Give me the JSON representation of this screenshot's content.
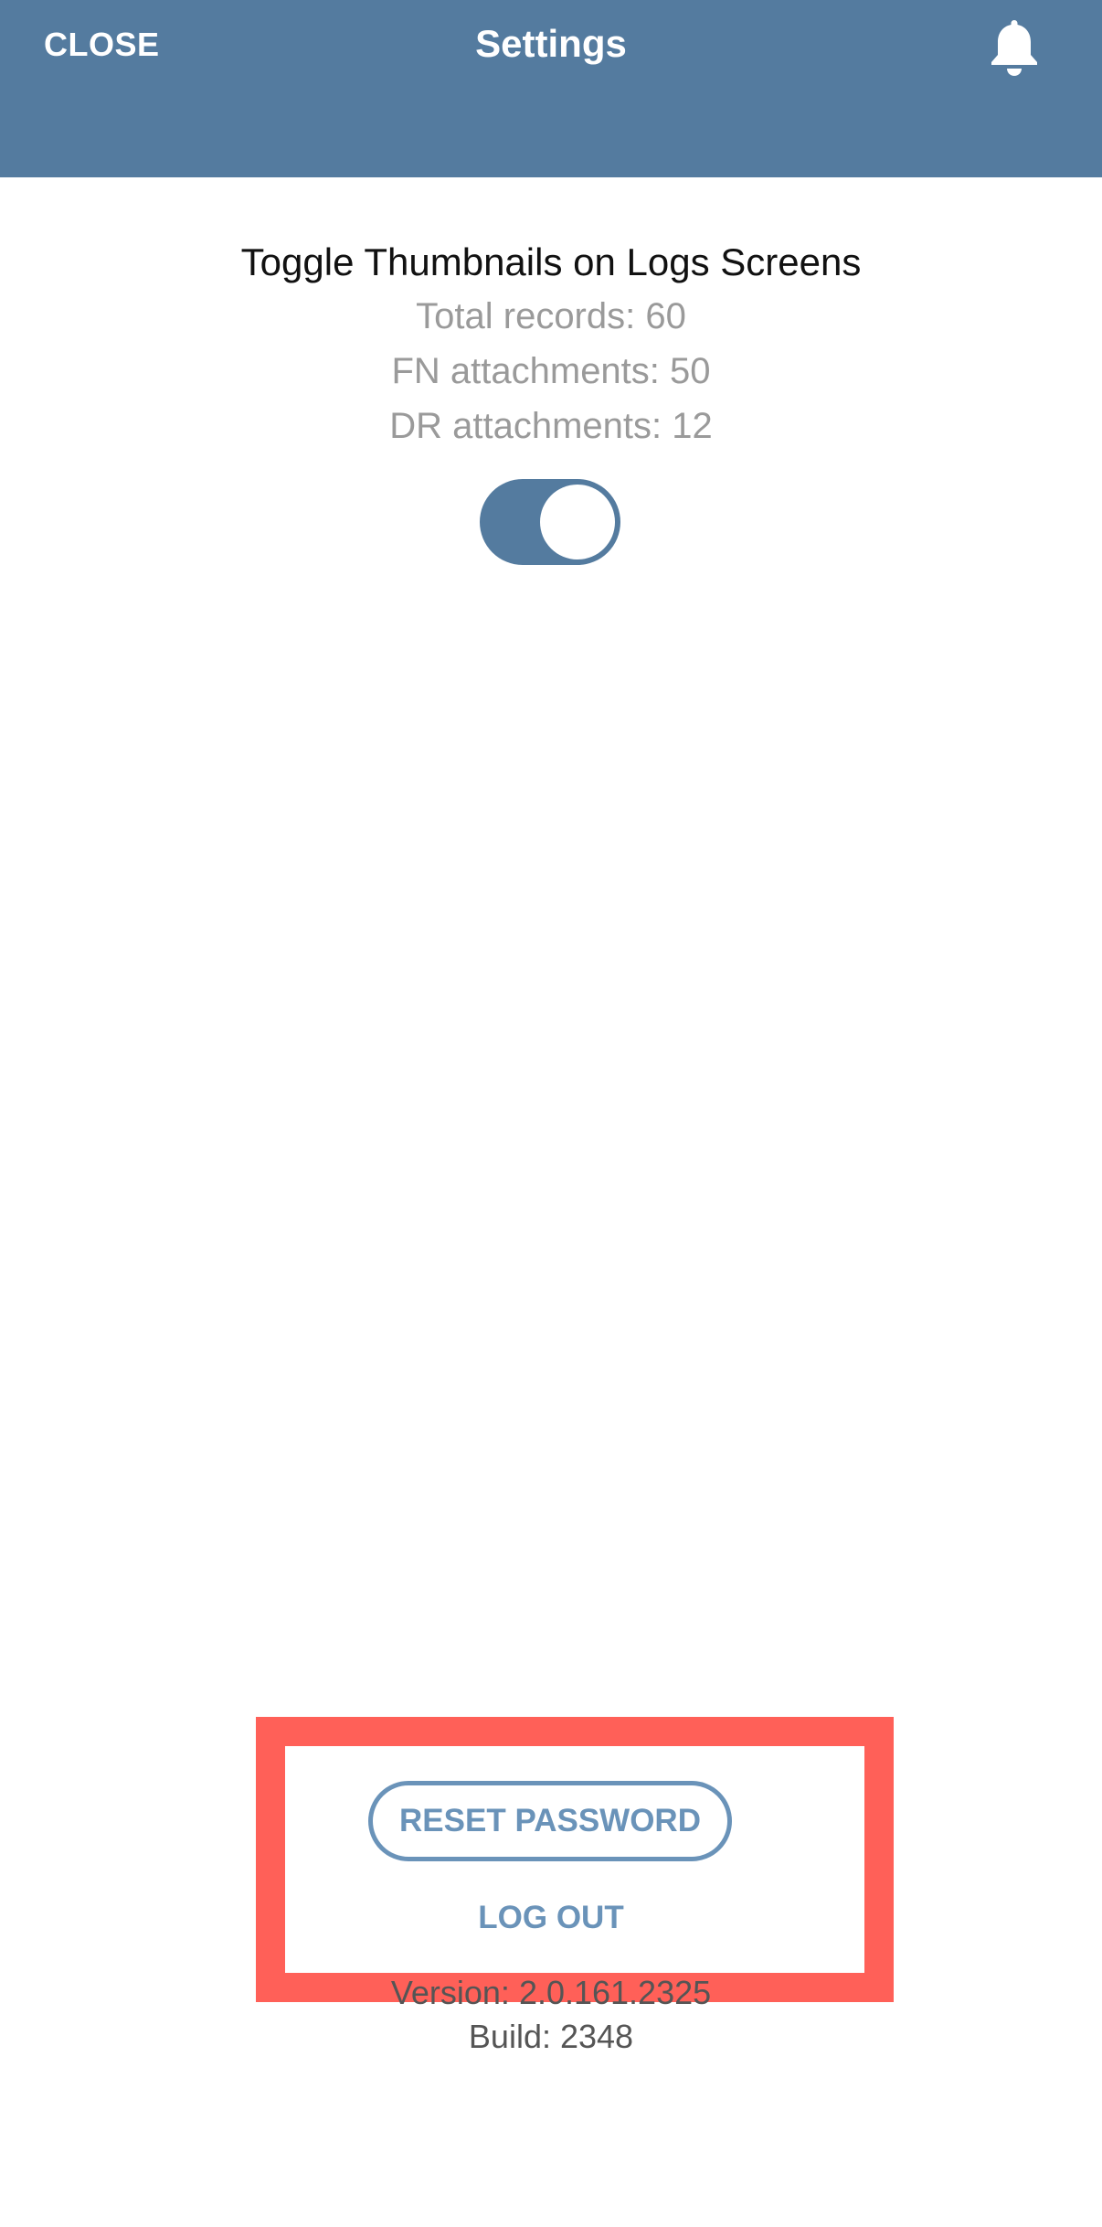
{
  "header": {
    "close_label": "CLOSE",
    "title": "Settings",
    "notification_icon": "bell-icon"
  },
  "settings": {
    "toggle_title": "Toggle Thumbnails on Logs Screens",
    "total_records": "Total records: 60",
    "fn_attachments": "FN attachments: 50",
    "dr_attachments": "DR attachments: 12",
    "thumbnails_enabled": true
  },
  "account": {
    "reset_password_label": "RESET PASSWORD",
    "logout_label": "LOG OUT"
  },
  "app_info": {
    "version": "Version: 2.0.161.2325",
    "build": "Build: 2348"
  },
  "colors": {
    "header_bg": "#547b9f",
    "accent": "#6a93b9",
    "highlight_border": "#ff6058",
    "muted_text": "#9a9a9a"
  }
}
